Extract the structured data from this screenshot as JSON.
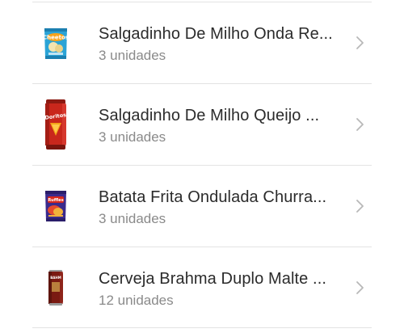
{
  "items": [
    {
      "title": "Salgadinho De Milho Onda Re...",
      "qty": "3 unidades",
      "thumb": "cheetos-bag-icon"
    },
    {
      "title": "Salgadinho De Milho Queijo ...",
      "qty": "3 unidades",
      "thumb": "doritos-canister-icon"
    },
    {
      "title": "Batata Frita Ondulada Churra...",
      "qty": "3 unidades",
      "thumb": "ruffles-bag-icon"
    },
    {
      "title": "Cerveja Brahma Duplo Malte ...",
      "qty": "12 unidades",
      "thumb": "brahma-can-icon"
    }
  ],
  "colors": {
    "title": "#2b2b2b",
    "subtitle": "#8a8a8a",
    "divider": "#e3e3e3",
    "chevron": "#b8b8b8"
  }
}
